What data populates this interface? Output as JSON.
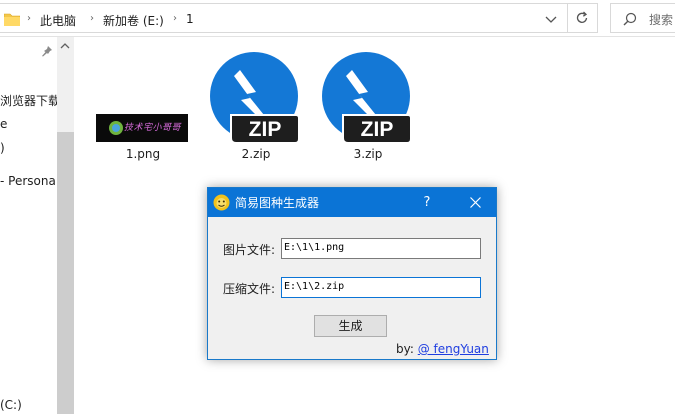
{
  "explorer": {
    "breadcrumb": [
      "此电脑",
      "新加卷 (E:)",
      "1"
    ],
    "search_placeholder": "搜索",
    "icons": {
      "folder": "folder-icon",
      "chevron": "chevron-right-icon",
      "dropdown": "chevron-down-icon",
      "refresh": "refresh-icon",
      "search": "search-icon"
    }
  },
  "nav": {
    "items": [
      "浏览器下载",
      "e",
      ")",
      "- Personal",
      "(C:)"
    ]
  },
  "files": [
    {
      "name": "1.png",
      "type": "png-thumbnail",
      "thumb_text": "技术宅小哥哥"
    },
    {
      "name": "2.zip",
      "type": "zip-icon",
      "badge": "ZIP"
    },
    {
      "name": "3.zip",
      "type": "zip-icon",
      "badge": "ZIP"
    }
  ],
  "dialog": {
    "title": "简易图种生成器",
    "help": "?",
    "image_label": "图片文件:",
    "image_value": "E:\\1\\1.png",
    "zip_label": "压缩文件:",
    "zip_value": "E:\\1\\2.zip",
    "button": "生成",
    "byline_prefix": "by:",
    "byline_link": "@ fengYuan"
  },
  "colors": {
    "title_bar": "#0b74d6",
    "zip_blue": "#1478d6",
    "zip_badge": "#1e1e1e",
    "link": "#1f3ee0"
  }
}
